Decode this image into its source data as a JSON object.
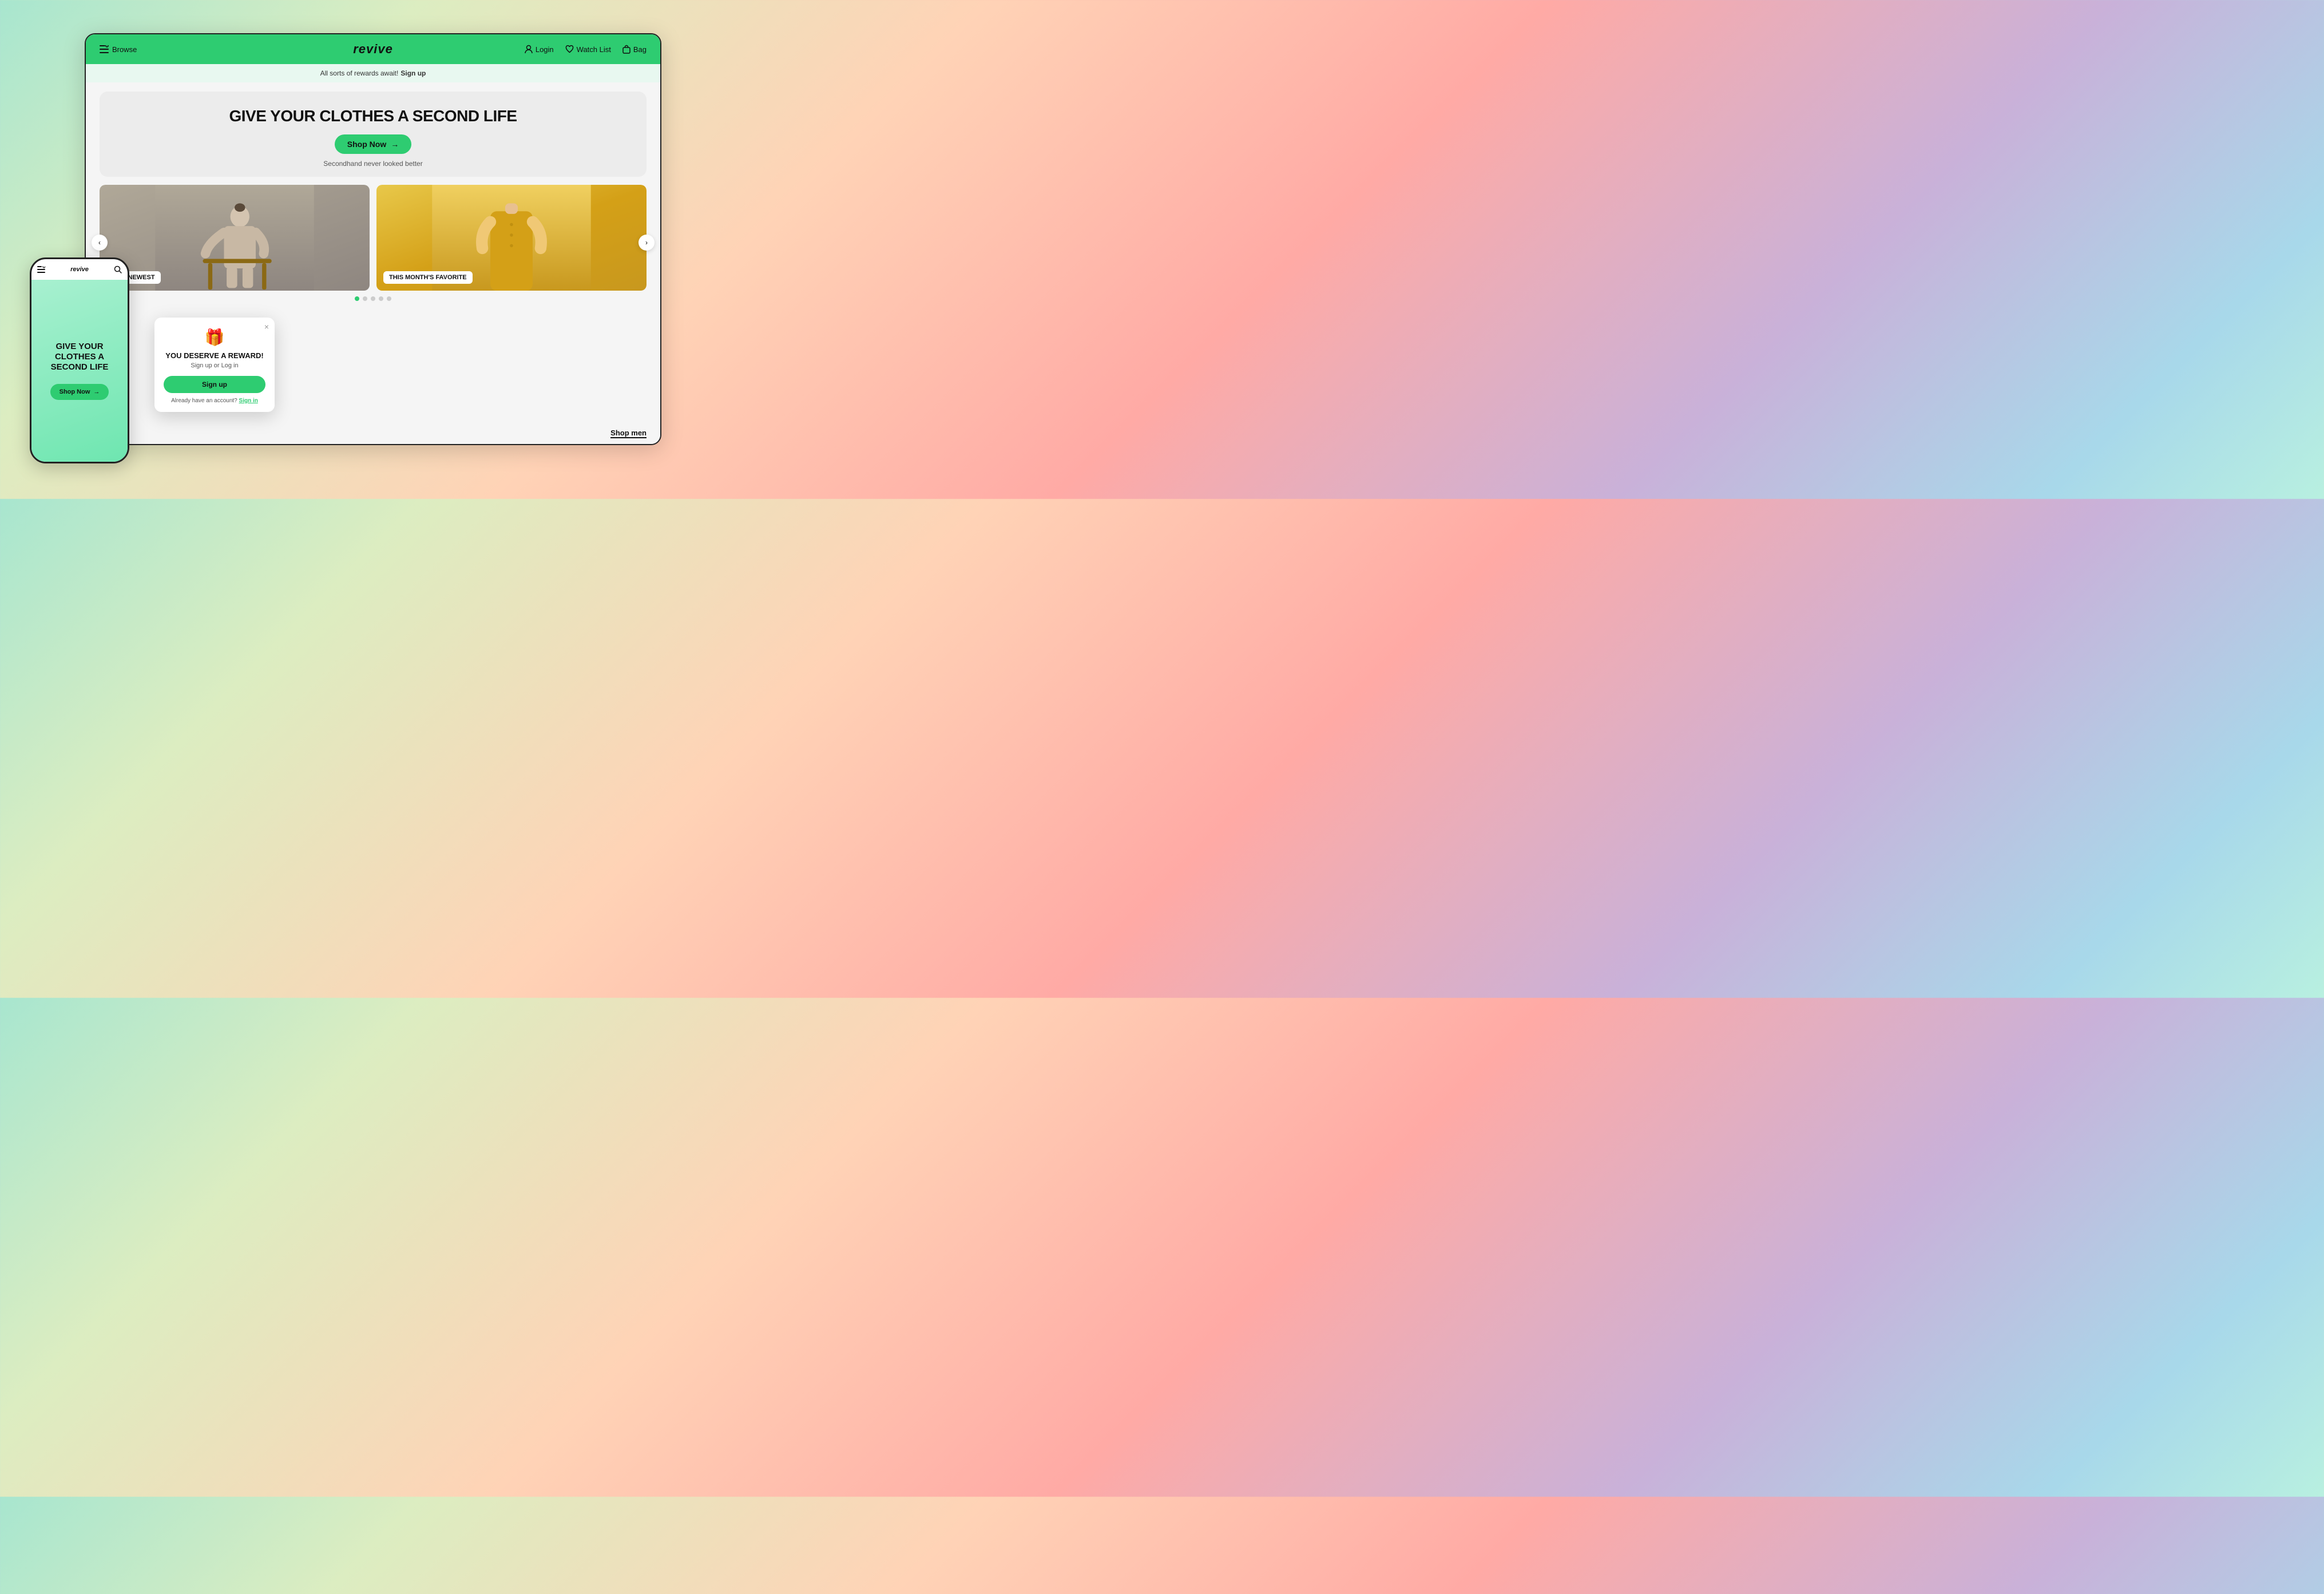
{
  "background": {
    "gradient": "linear-gradient(135deg, #a8e6cf, #dcedc1, #ffd3b6, #ffaaa5, #c9b1d9, #a8d8ea)"
  },
  "desktop": {
    "navbar": {
      "browse_label": "Browse",
      "logo": "revive",
      "login_label": "Login",
      "watchlist_label": "Watch List",
      "bag_label": "Bag"
    },
    "banner": {
      "text": "All sorts of rewards await!",
      "signup_label": "Sign up"
    },
    "hero": {
      "title": "GIVE YOUR CLOTHES A SECOND LIFE",
      "shop_now_label": "Shop Now",
      "subtitle": "Secondhand never looked better"
    },
    "carousel": {
      "items": [
        {
          "label": "OUR NEWEST",
          "bg": "gray"
        },
        {
          "label": "THIS MONTH'S FAVORITE",
          "bg": "yellow"
        }
      ],
      "dots": [
        true,
        false,
        false,
        false,
        false
      ],
      "prev_label": "‹",
      "next_label": "›"
    },
    "shop_men_label": "Shop men"
  },
  "mobile": {
    "logo": "revive",
    "hero_title": "GIVE YOUR CLOTHES A SECOND LIFE",
    "shop_now_label": "Shop Now"
  },
  "popup": {
    "close_label": "×",
    "icon": "🎁",
    "title": "YOU DESERVE A REWARD!",
    "subtitle": "Sign up or Log in",
    "signup_label": "Sign up",
    "signin_prompt": "Already have an account?",
    "signin_label": "Sign in"
  }
}
